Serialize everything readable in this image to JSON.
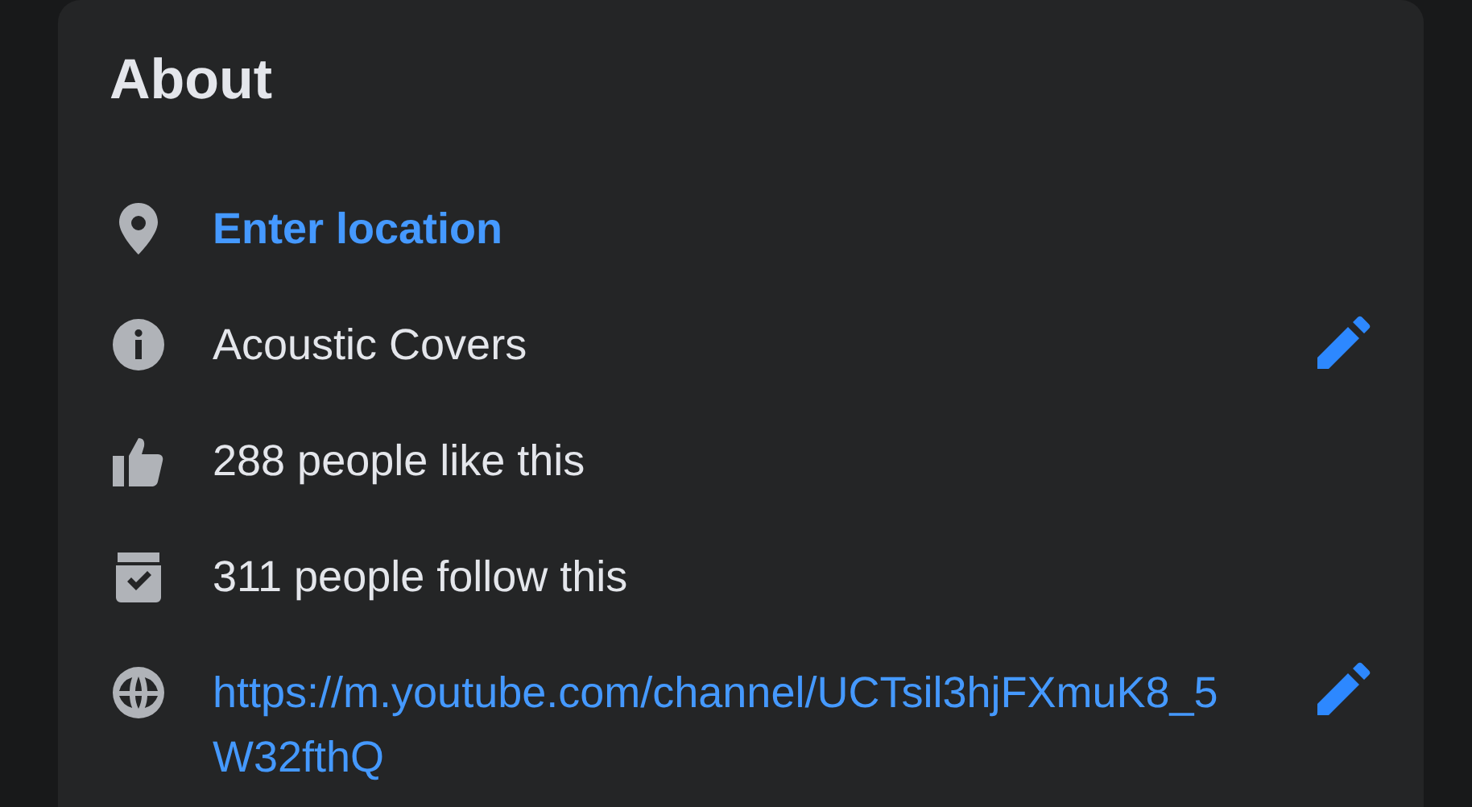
{
  "card": {
    "title": "About",
    "rows": [
      {
        "kind": "location",
        "text": "Enter location",
        "editable": false
      },
      {
        "kind": "category",
        "text": "Acoustic Covers",
        "editable": true
      },
      {
        "kind": "likes",
        "text": "288 people like this",
        "editable": false
      },
      {
        "kind": "follows",
        "text": "311 people follow this",
        "editable": false
      },
      {
        "kind": "website",
        "text": "https://m.youtube.com/channel/UCTsil3hjFXmuK8_5W32fthQ",
        "editable": true
      }
    ]
  }
}
